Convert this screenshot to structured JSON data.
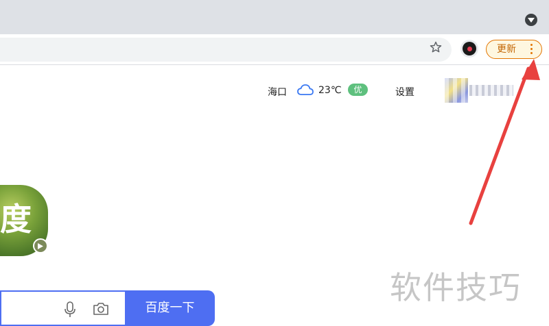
{
  "browser": {
    "update_label": "更新",
    "icons": {
      "tab_search": "chevron-down-circle-icon",
      "bookmark": "star-outline-icon",
      "extension": "record-extension-icon",
      "menu": "kebab-menu-icon"
    },
    "accent_color": "#e37400"
  },
  "header": {
    "city": "海口",
    "temperature": "23℃",
    "air_quality": "优",
    "settings_label": "设置",
    "weather_icon": "cloudy-icon",
    "air_quality_color": "#5ec07e"
  },
  "logo": {
    "char": "度"
  },
  "search": {
    "button_label": "百度一下",
    "icons": {
      "voice": "microphone-icon",
      "image": "camera-icon"
    },
    "button_color": "#4e6ef2"
  },
  "watermark": "软件技巧"
}
